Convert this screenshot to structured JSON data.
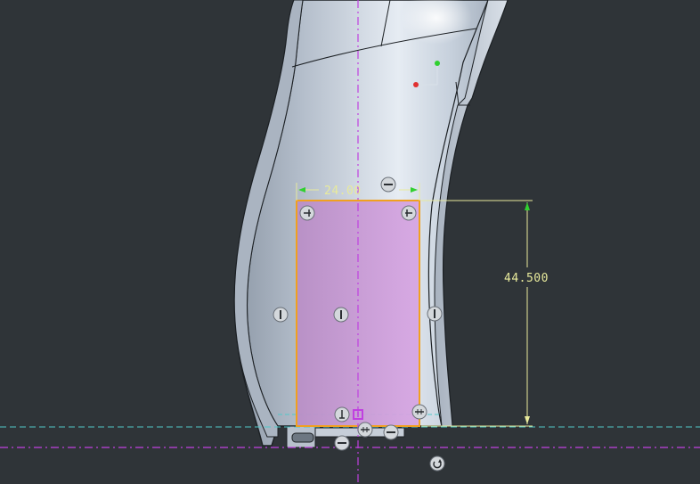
{
  "viewport": {
    "background": "#2f3438"
  },
  "sketch": {
    "width_dimension": "24.00",
    "height_dimension": "44.500",
    "profile_color": "#f0a020",
    "fill_color": "#c89bd8",
    "centerline_color": "#c040e0",
    "dimension_color": "#e8ea9c",
    "reference_line_color": "#50c8c8"
  },
  "model": {
    "body_color": "#c8d2de",
    "edge_color": "#1c2024"
  },
  "triad": {
    "x_color": "#e03030",
    "y_color": "#30d030"
  },
  "icons": [
    "horizontal-constraint-icon",
    "vertical-constraint-icon",
    "tangent-constraint-icon",
    "perpendicular-constraint-icon",
    "symmetry-constraint-icon",
    "rotate-handle-icon"
  ]
}
